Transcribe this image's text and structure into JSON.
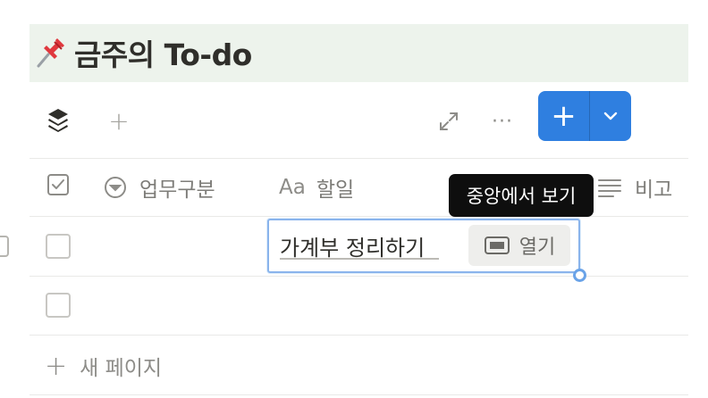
{
  "page": {
    "title": "금주의 To-do",
    "title_icon": "pushpin-icon"
  },
  "toolbar": {
    "layers_icon": "layers-icon",
    "add_view_label": "+",
    "expand_icon": "expand-icon",
    "more_label": "···",
    "new_button_label": "+",
    "new_button_caret_icon": "chevron-down-icon",
    "accent_color": "#2f7fe0"
  },
  "table": {
    "columns": [
      {
        "icon": "checkbox-icon",
        "label": ""
      },
      {
        "icon": "select-icon",
        "label": "업무구분"
      },
      {
        "icon": "text-icon",
        "label": "할일",
        "prefix": "Aa"
      },
      {
        "icon": "lines-icon",
        "label": "비고"
      }
    ],
    "rows": [
      {
        "checked": false,
        "task": "가계부 정리하기",
        "editing": true
      },
      {
        "checked": false,
        "task": ""
      }
    ],
    "open_button_label": "열기",
    "tooltip": "중앙에서 보기",
    "new_page_label": "새 페이지",
    "new_page_icon": "+"
  }
}
